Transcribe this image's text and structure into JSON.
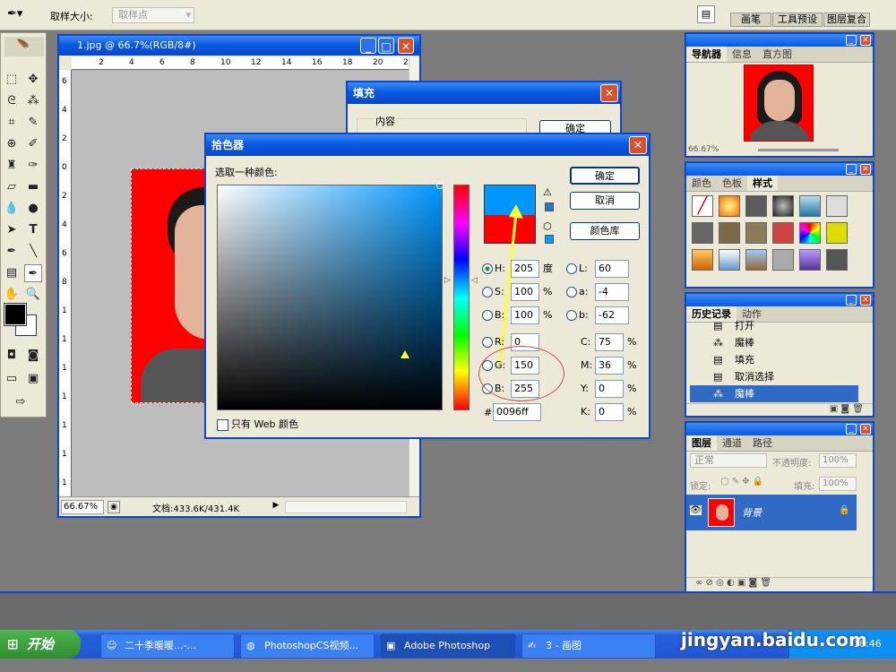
{
  "options_bar": {
    "sample_size_label": "取样大小:",
    "sample_value": "取样点",
    "dock_tabs": [
      "画笔",
      "工具预设",
      "图层复合"
    ]
  },
  "document": {
    "title": "1.jpg @ 66.7%(RGB/8#)",
    "zoom": "66.67%",
    "doc_size": "文档:433.6K/431.4K",
    "ruler_top": [
      "2",
      "4",
      "6",
      "8",
      "10",
      "12",
      "14",
      "16",
      "18",
      "20",
      "22"
    ],
    "ruler_left": [
      "6",
      "4",
      "2",
      "0",
      "2",
      "4",
      "6",
      "8",
      "1",
      "1",
      "1",
      "1",
      "1",
      "1",
      "1"
    ]
  },
  "fill_dialog": {
    "title": "填充",
    "group_label": "内容",
    "ok": "确定"
  },
  "color_picker": {
    "title": "拾色器",
    "prompt": "选取一种颜色:",
    "ok": "确定",
    "cancel": "取消",
    "library": "颜色库",
    "web_only": "只有 Web 颜色",
    "new_color": "#0096ff",
    "old_color": "#ff0000",
    "H": "205",
    "S": "100",
    "Bv": "100",
    "R": "0",
    "G": "150",
    "B": "255",
    "L": "60",
    "a": "-4",
    "b": "-62",
    "C": "75",
    "M": "36",
    "Y": "0",
    "K": "0",
    "hex": "0096ff",
    "labels": {
      "H": "H:",
      "S": "S:",
      "Bv": "B:",
      "R": "R:",
      "G": "G:",
      "B": "B:",
      "L": "L:",
      "a": "a:",
      "b": "b:",
      "C": "C:",
      "M": "M:",
      "Y": "Y:",
      "K": "K:",
      "hash": "#"
    },
    "units": {
      "deg": "度",
      "pct": "%"
    }
  },
  "navigator": {
    "tabs": [
      "导航器",
      "信息",
      "直方图"
    ],
    "zoom": "66.67%"
  },
  "swatches_panel": {
    "tabs": [
      "颜色",
      "色板",
      "样式"
    ]
  },
  "history": {
    "tabs": [
      "历史记录",
      "动作"
    ],
    "items": [
      "打开",
      "魔棒",
      "填充",
      "取消选择",
      "魔棒"
    ]
  },
  "layers": {
    "tabs": [
      "图层",
      "通道",
      "路径"
    ],
    "blend_mode": "正常",
    "opacity_label": "不透明度:",
    "opacity": "100%",
    "lock_label": "锁定:",
    "fill_label": "填充:",
    "fill": "100%",
    "layer_name": "背景"
  },
  "taskbar": {
    "start": "开始",
    "items": [
      "二十季暖暖...-...",
      "PhotoshopCS视频...",
      "Adobe Photoshop",
      "3 - 画图"
    ],
    "clock": "16:46"
  },
  "watermark": "jingyan.baidu.com"
}
